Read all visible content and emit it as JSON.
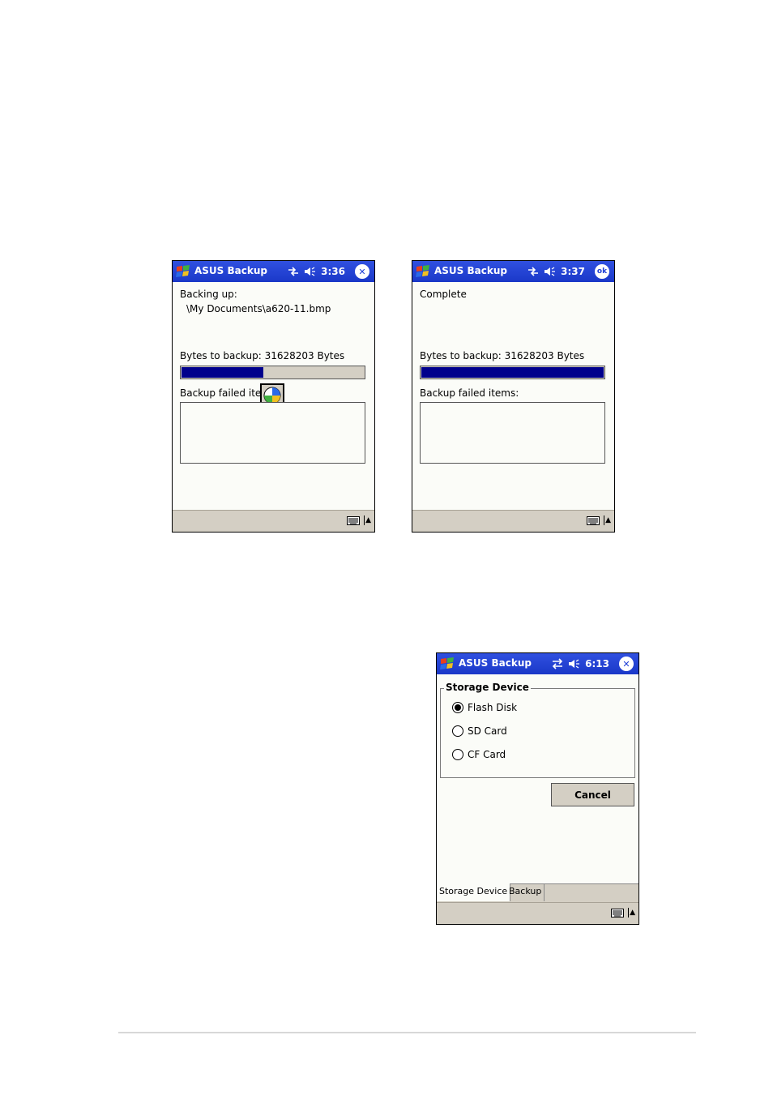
{
  "screen1": {
    "title": "ASUS Backup",
    "time": "3:36",
    "close_label": "✕",
    "backing_label": "Backing up:",
    "file_path": "\\My Documents\\a620-11.bmp",
    "bytes_label": "Bytes to backup: 31628203 Bytes",
    "progress": 0.45,
    "failed_label": "Backup failed iter",
    "icons": [
      "windows-logo-icon",
      "connectivity-icon",
      "speaker-icon",
      "close-icon",
      "keyboard-icon",
      "busy-icon"
    ]
  },
  "screen2": {
    "title": "ASUS Backup",
    "time": "3:37",
    "ok_label": "ok",
    "status": "Complete",
    "bytes_label": "Bytes to backup: 31628203 Bytes",
    "progress": 1.0,
    "failed_label": "Backup failed items:"
  },
  "screen3": {
    "title": "ASUS Backup",
    "time": "6:13",
    "close_label": "✕",
    "group_title": "Storage Device",
    "options": [
      {
        "label": "Flash Disk",
        "selected": true
      },
      {
        "label": "SD Card",
        "selected": false
      },
      {
        "label": "CF Card",
        "selected": false
      }
    ],
    "cancel_label": "Cancel",
    "tabs": [
      "Storage Device",
      "Backup"
    ]
  },
  "colors": {
    "titlebar": "#1f3fd6",
    "progress_fill": "#00008c",
    "chrome": "#d4cfc4"
  }
}
